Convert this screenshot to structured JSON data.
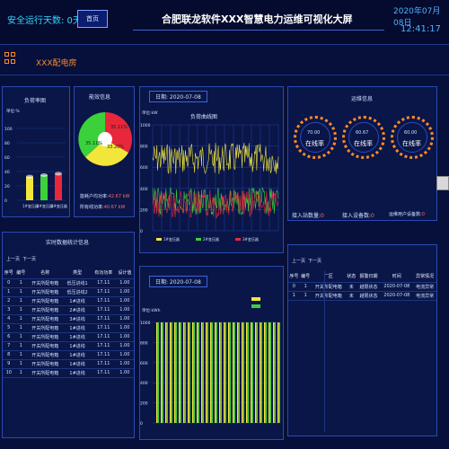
{
  "header": {
    "safe_run": "安全运行天数: 0天",
    "home_button": "首页",
    "title": "合肥联龙软件XXX智慧电力运维可视化大屏",
    "date": "2020年07月08日",
    "time": "12:41:17"
  },
  "subheader": {
    "room_title": "XXX配电房"
  },
  "load_panel": {
    "title": "负荷率图",
    "ylabel": "单位:%",
    "categories": [
      "1#变压器",
      "2#变压器",
      "3#变压器"
    ],
    "values": [
      33,
      35,
      37
    ],
    "colors": [
      "#f2e63a",
      "#3bd13b",
      "#e8283a"
    ],
    "yticks": [
      "100",
      "80",
      "60",
      "40",
      "20",
      "0"
    ]
  },
  "eff_panel": {
    "title": "能效信息",
    "pie_labels": [
      "35.11%",
      "35.11%",
      "33.20%"
    ],
    "line1_label": "能耗户均功率:",
    "line1_value": "42.67 kW",
    "line2_label": "所有线功率:",
    "line2_value": "40.67 kW"
  },
  "curve_panel": {
    "date_label": "日期: 2020-07-08",
    "title": "负荷曲线图",
    "ylabel": "单位:kW",
    "yticks": [
      "1000",
      "800",
      "600",
      "400",
      "200",
      "0"
    ],
    "legend": [
      "1#变压器",
      "2#变压器",
      "3#变压器"
    ]
  },
  "ops_panel": {
    "title": "运维信息",
    "circles": [
      {
        "value": "70.00",
        "label": "在线率"
      },
      {
        "value": "60.67",
        "label": "在线率"
      },
      {
        "value": "60.00",
        "label": "在线率"
      }
    ],
    "notes": [
      {
        "label": "接入站数量:",
        "value": "0"
      },
      {
        "label": "接入设备数:",
        "value": "0"
      },
      {
        "label": "运维用户设备数:",
        "value": "0"
      }
    ]
  },
  "stats_panel": {
    "title": "实时数据统计信息",
    "pager": [
      "上一页",
      "下一页"
    ],
    "headers": [
      "序号",
      "编号",
      "名称",
      "类型",
      "有功功率",
      "设计值"
    ],
    "rows": [
      [
        "0",
        "1",
        "开关所配电箱",
        "低压进线1",
        "17.11",
        "1.00"
      ],
      [
        "1",
        "1",
        "开关所配电箱",
        "低压进线2",
        "17.11",
        "1.00"
      ],
      [
        "2",
        "1",
        "开关所配电箱",
        "1#进线",
        "17.11",
        "1.00"
      ],
      [
        "3",
        "1",
        "开关所配电箱",
        "2#进线",
        "17.11",
        "1.00"
      ],
      [
        "4",
        "1",
        "开关所配电箱",
        "3#进线",
        "17.11",
        "1.00"
      ],
      [
        "5",
        "1",
        "开关所配电箱",
        "1#进线",
        "17.11",
        "1.00"
      ],
      [
        "6",
        "1",
        "开关所配电箱",
        "1#进线",
        "17.11",
        "1.00"
      ],
      [
        "7",
        "1",
        "开关所配电箱",
        "1#进线",
        "17.11",
        "1.00"
      ],
      [
        "8",
        "1",
        "开关所配电箱",
        "1#进线",
        "17.11",
        "1.00"
      ],
      [
        "9",
        "1",
        "开关所配电箱",
        "1#进线",
        "17.11",
        "1.00"
      ],
      [
        "10",
        "1",
        "开关所配电箱",
        "1#进线",
        "17.11",
        "1.00"
      ]
    ]
  },
  "bars_panel": {
    "date_label": "日期: 2020-07-08",
    "ylabel": "单位:kWh",
    "legend": [
      "",
      ""
    ],
    "yticks": [
      "1000",
      "800",
      "600",
      "400",
      "200",
      "0"
    ]
  },
  "table2_panel": {
    "pager": [
      "上一页",
      "下一页"
    ],
    "headers": [
      "序号",
      "编号",
      "厂区",
      "状态",
      "报警日期",
      "时间",
      "异常情况"
    ],
    "rows": [
      [
        "0",
        "1",
        "开关所配电箱",
        "未",
        "越限状态",
        "2020-07-08",
        "电流异常"
      ],
      [
        "1",
        "1",
        "开关所配电箱",
        "未",
        "越限状态",
        "2020-07-08",
        "电流异常"
      ]
    ]
  }
}
